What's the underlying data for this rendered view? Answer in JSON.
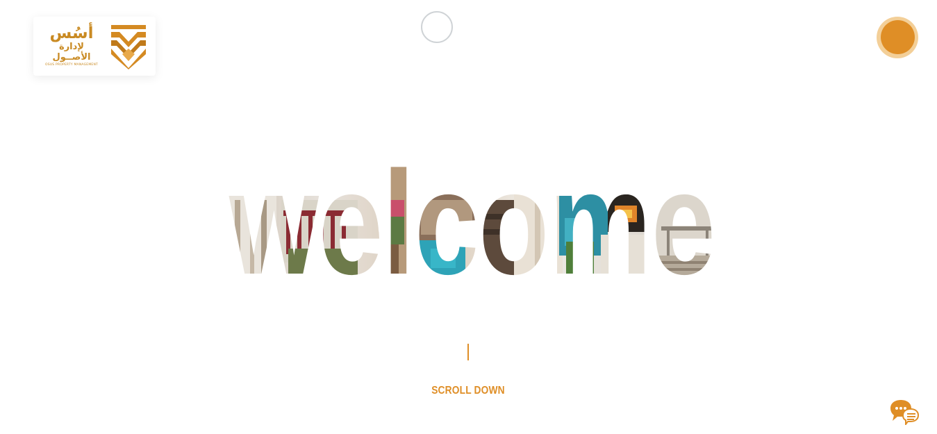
{
  "logo": {
    "arabic_name": "أسُس",
    "arabic_sub": "لإدارة الأصــول",
    "english_sub": "OSUS PROPERTY MANAGEMENT"
  },
  "hero": {
    "headline": "welcome"
  },
  "scroll": {
    "label": "SCROLL DOWN"
  },
  "colors": {
    "brand_orange": "#df8e26",
    "logo_gold": "#c98a22",
    "menu_ring": "#f3cf98"
  },
  "icons": {
    "menu": "circle-menu-icon",
    "loader": "loading-ring-icon",
    "chat": "chat-bubble-icon"
  }
}
